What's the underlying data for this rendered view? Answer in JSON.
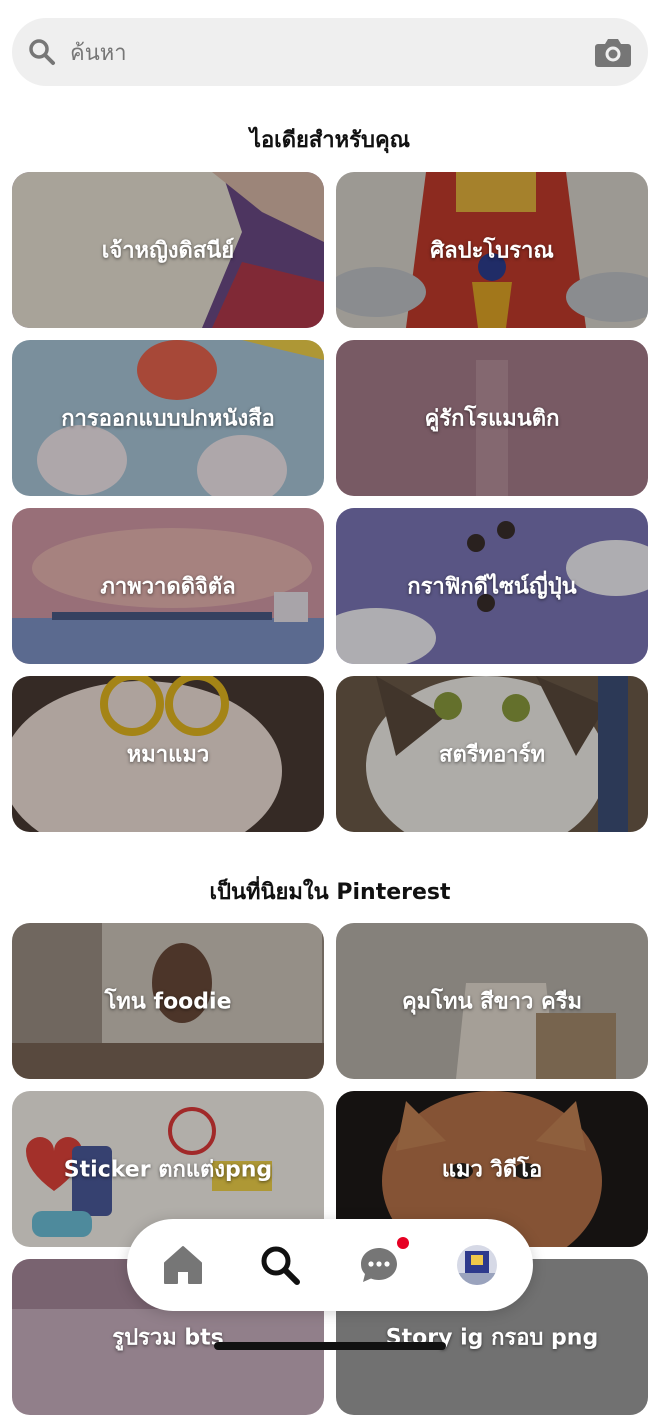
{
  "search": {
    "placeholder": "ค้นหา"
  },
  "sections": {
    "ideas_title": "ไอเดียสำหรับคุณ",
    "popular_title": "เป็นที่นิยมใน Pinterest"
  },
  "ideas": [
    {
      "label": "เจ้าหญิงดิสนีย์"
    },
    {
      "label": "ศิลปะโบราณ"
    },
    {
      "label": "การออกแบบปกหนังสือ"
    },
    {
      "label": "คู่รักโรแมนติก"
    },
    {
      "label": "ภาพวาดดิจิตัล"
    },
    {
      "label": "กราฟิกดีไซน์ญี่ปุ่น"
    },
    {
      "label": "หมาแมว"
    },
    {
      "label": "สตรีทอาร์ท"
    }
  ],
  "popular": [
    {
      "label": "โทน foodie"
    },
    {
      "label": "คุมโทน สีขาว ครีม"
    },
    {
      "label": "Sticker ตกแต่งpng"
    },
    {
      "label": "แมว วิดีโอ"
    },
    {
      "label": "รูปรวม bts"
    },
    {
      "label": "Story ig กรอบ png"
    }
  ],
  "tabbar": {
    "icons": [
      "home-icon",
      "search-icon",
      "message-icon",
      "profile-avatar"
    ],
    "active": "search-icon",
    "notification_color": "#e60023"
  },
  "colors": {
    "search_bg": "#efefef",
    "placeholder": "#767676",
    "text": "#111111"
  }
}
